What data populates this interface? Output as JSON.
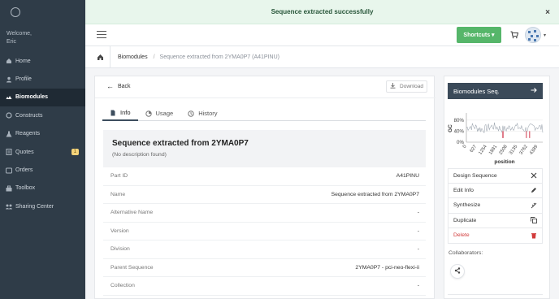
{
  "toast": {
    "message": "Sequence extracted successfully",
    "close": "×"
  },
  "sidebar": {
    "welcome": "Welcome,",
    "user": "Eric",
    "items": [
      {
        "label": "Home",
        "icon": "home-icon"
      },
      {
        "label": "Profile",
        "icon": "user-icon"
      },
      {
        "label": "Biomodules",
        "icon": "biomodules-icon",
        "active": true
      },
      {
        "label": "Constructs",
        "icon": "constructs-icon"
      },
      {
        "label": "Reagents",
        "icon": "reagents-icon"
      },
      {
        "label": "Quotes",
        "icon": "quotes-icon",
        "badge": "1"
      },
      {
        "label": "Orders",
        "icon": "orders-icon"
      },
      {
        "label": "Toolbox",
        "icon": "toolbox-icon"
      },
      {
        "label": "Sharing Center",
        "icon": "share-icon"
      }
    ]
  },
  "topbar": {
    "shortcuts_label": "Shortcuts ▾"
  },
  "breadcrumb": {
    "items": [
      "Biomodules",
      "Sequence extracted from 2YMA0P7 (A41PINU)"
    ]
  },
  "card": {
    "back_label": "Back",
    "download_label": "Download",
    "tabs": [
      {
        "label": "Info",
        "active": true
      },
      {
        "label": "Usage"
      },
      {
        "label": "History"
      }
    ],
    "title": "Sequence extracted from 2YMA0P7",
    "description": "(No description found)",
    "fields": [
      {
        "key": "Part ID",
        "value": "A41PINU"
      },
      {
        "key": "Name",
        "value": "Sequence extracted from 2YMA0P7"
      },
      {
        "key": "Alternative Name",
        "value": "-"
      },
      {
        "key": "Version",
        "value": "-"
      },
      {
        "key": "Division",
        "value": "-"
      },
      {
        "key": "Parent Sequence",
        "value": "2YMA0P7 - pci-neo-flexi-ii"
      },
      {
        "key": "Collection",
        "value": "-"
      }
    ]
  },
  "panel": {
    "header": "Biomodules Seq.",
    "chart_data": {
      "type": "line",
      "ylabel": "GC",
      "xlabel": "position",
      "yticks": [
        "80%",
        "40%",
        "0%"
      ],
      "xticks": [
        "0",
        "627",
        "1254",
        "1881",
        "2508",
        "3135",
        "3762",
        "4389"
      ],
      "ylim": [
        0,
        100
      ],
      "xlim": [
        0,
        4700
      ]
    },
    "actions": [
      {
        "label": "Design Sequence",
        "icon": "design-icon"
      },
      {
        "label": "Edit Info",
        "icon": "pencil-icon"
      },
      {
        "label": "Synthesize",
        "icon": "synthesize-icon"
      },
      {
        "label": "Duplicate",
        "icon": "duplicate-icon"
      },
      {
        "label": "Delete",
        "icon": "trash-icon",
        "danger": true
      }
    ],
    "collaborators_label": "Collaborators:"
  }
}
